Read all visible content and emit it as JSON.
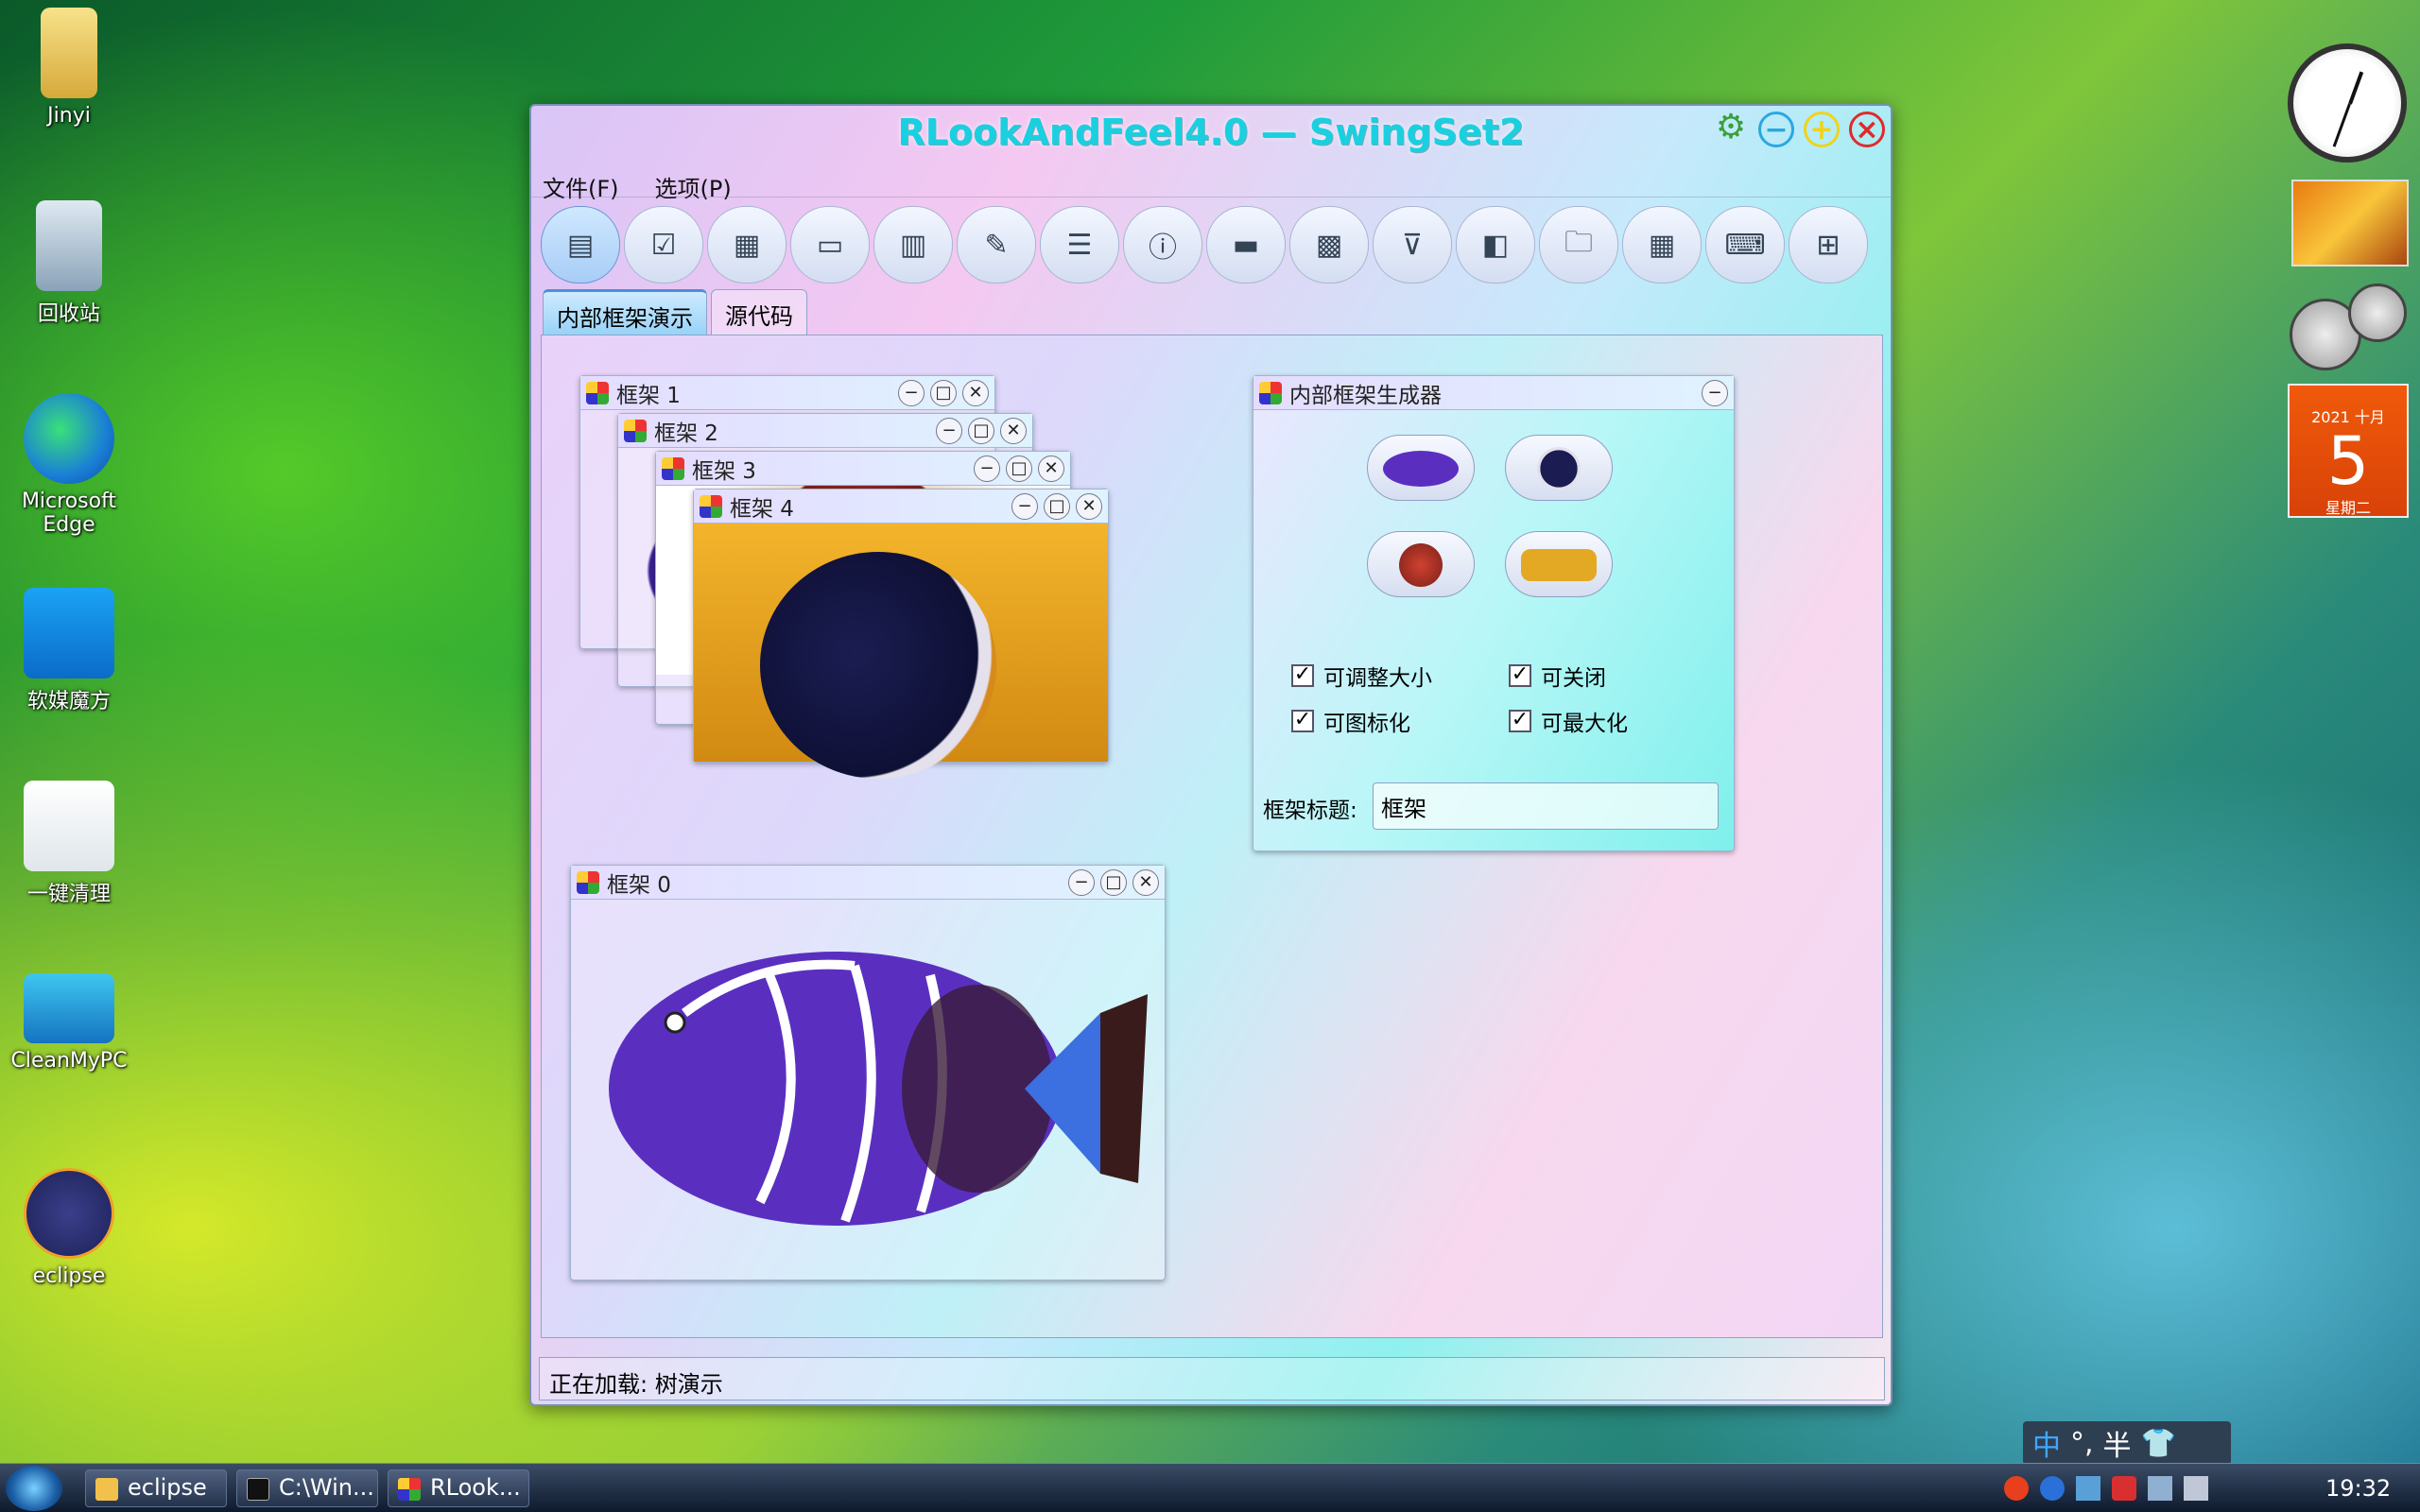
{
  "desktop": {
    "icons": [
      {
        "label": "Jinyi"
      },
      {
        "label": "回收站"
      },
      {
        "label": "Microsoft Edge"
      },
      {
        "label": "软媒魔方"
      },
      {
        "label": "一键清理"
      },
      {
        "label": "CleanMyPC"
      },
      {
        "label": "eclipse"
      }
    ]
  },
  "gadgets": {
    "calendar": {
      "year_month": "2021 十月",
      "day": "5",
      "weekday": "星期二"
    }
  },
  "window": {
    "title": "RLookAndFeel4.0 — SwingSet2",
    "menu": {
      "file": "文件(F)",
      "options": "选项(P)"
    },
    "tabs": [
      {
        "label": "内部框架演示"
      },
      {
        "label": "源代码"
      }
    ],
    "frames": {
      "frame1": "框架 1",
      "frame2": "框架 2",
      "frame3": "框架 3",
      "frame4": "框架 4",
      "frame0": "框架 0"
    },
    "generator": {
      "title": "内部框架生成器",
      "checkboxes": {
        "resizable": "可调整大小",
        "closable": "可关闭",
        "iconifiable": "可图标化",
        "maximizable": "可最大化"
      },
      "title_label": "框架标题:",
      "title_value": "框架"
    },
    "status": "正在加载: 树演示"
  },
  "taskbar": {
    "items": [
      {
        "label": "eclipse"
      },
      {
        "label": "C:\\Win..."
      },
      {
        "label": "RLook..."
      }
    ],
    "ime": {
      "lang": "中",
      "punct": "°,",
      "width": "半"
    },
    "clock": "19:32"
  },
  "colors": {
    "title": "#19d0e0",
    "close": "#e02a2a",
    "minimize": "#2aa7e0",
    "maximize": "#f2d21a"
  }
}
